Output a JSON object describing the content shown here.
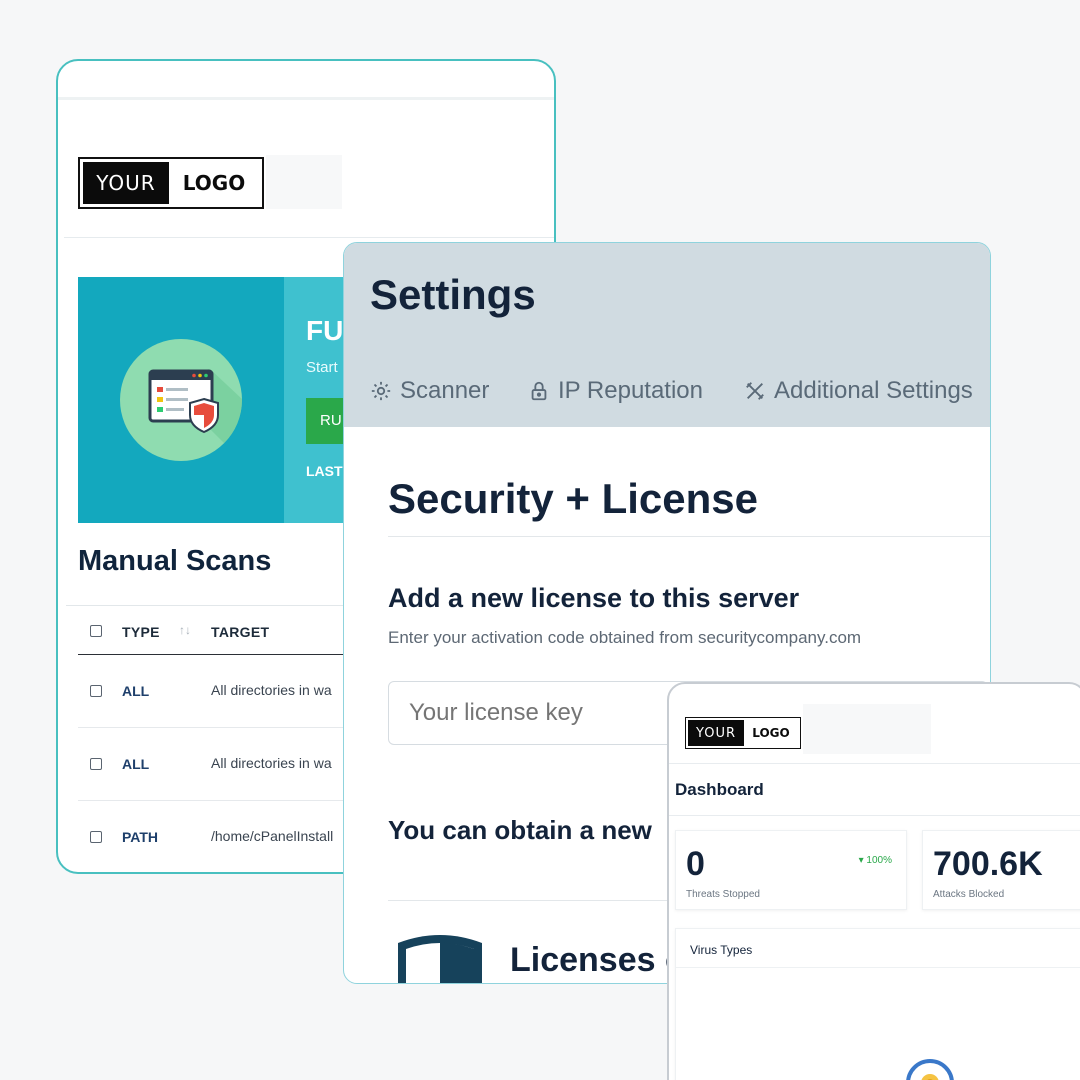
{
  "scans_card": {
    "logo": {
      "word1": "YOUR",
      "word2": "LOGO"
    },
    "banner": {
      "title": "FU",
      "subtitle": "Start",
      "button": "RU",
      "last": "LAST"
    },
    "title": "Manual Scans",
    "table": {
      "columns": [
        "TYPE",
        "TARGET"
      ],
      "sort_icon": "sort-arrows-icon",
      "rows": [
        {
          "type": "ALL",
          "target": "All directories in wa"
        },
        {
          "type": "ALL",
          "target": "All directories in wa"
        },
        {
          "type": "PATH",
          "target": "/home/cPanelInstall"
        }
      ]
    }
  },
  "settings_card": {
    "title": "Settings",
    "tabs": [
      {
        "label": "Scanner",
        "icon": "gear-icon"
      },
      {
        "label": "IP Reputation",
        "icon": "lock-icon"
      },
      {
        "label": "Additional Settings",
        "icon": "tools-icon"
      }
    ],
    "section_title": "Security + License",
    "add_license": {
      "title": "Add a new license to this server",
      "description": "Enter your activation code obtained from securitycompany.com",
      "placeholder": "Your license key"
    },
    "obtain_text": "You can obtain a new",
    "licenses_text": "Licenses o"
  },
  "dashboard_card": {
    "logo": {
      "word1": "YOUR",
      "word2": "LOGO"
    },
    "title": "Dashboard",
    "stats": [
      {
        "value": "0",
        "label": "Threats Stopped",
        "change": "100%"
      },
      {
        "value": "700.6K",
        "label": "Attacks Blocked"
      }
    ],
    "virus_types_title": "Virus Types"
  },
  "colors": {
    "accent_teal": "#13a8be",
    "banner_light": "#3fc1cf",
    "run_button": "#2aa84a",
    "settings_header": "#d0dbe1",
    "navy_text": "#13233a"
  }
}
